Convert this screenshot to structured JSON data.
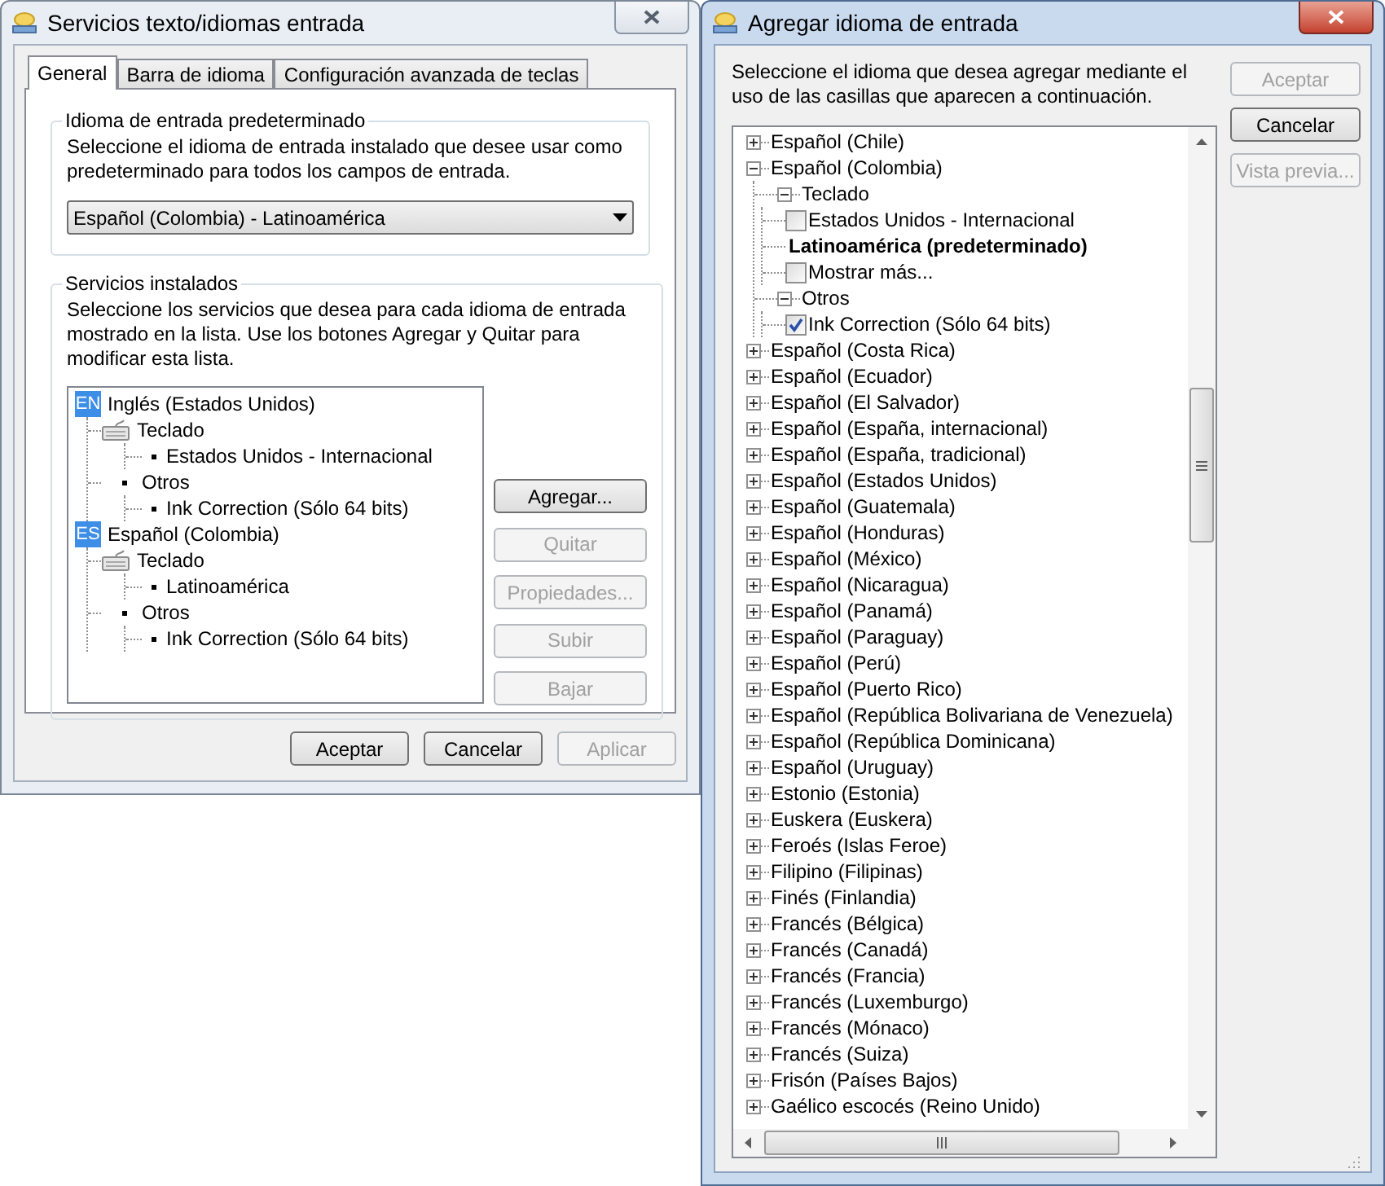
{
  "left_window": {
    "title": "Servicios texto/idiomas entrada",
    "tabs": [
      {
        "label": "General",
        "selected": true
      },
      {
        "label": "Barra de idioma",
        "selected": false
      },
      {
        "label": "Configuración avanzada de teclas",
        "selected": false
      }
    ],
    "default_language": {
      "legend": "Idioma de entrada predeterminado",
      "description": "Seleccione el idioma de entrada instalado que desee usar como predeterminado para todos los campos de entrada.",
      "value": "Español (Colombia) - Latinoamérica"
    },
    "installed_services": {
      "legend": "Servicios instalados",
      "description": "Seleccione los servicios que desea para cada idioma de entrada mostrado en la lista. Use los botones Agregar y Quitar para modificar esta lista.",
      "tree": [
        {
          "badge": "EN",
          "label": "Inglés (Estados Unidos)",
          "children": [
            {
              "kind": "keyboard",
              "label": "Teclado",
              "children": [
                {
                  "label": "Estados Unidos - Internacional"
                }
              ]
            },
            {
              "kind": "bullet",
              "label": "Otros",
              "children": [
                {
                  "label": "Ink Correction (Sólo 64 bits)"
                }
              ]
            }
          ]
        },
        {
          "badge": "ES",
          "label": "Español (Colombia)",
          "children": [
            {
              "kind": "keyboard",
              "label": "Teclado",
              "children": [
                {
                  "label": "Latinoamérica"
                }
              ]
            },
            {
              "kind": "bullet",
              "label": "Otros",
              "children": [
                {
                  "label": "Ink Correction (Sólo 64 bits)"
                }
              ]
            }
          ]
        }
      ],
      "buttons": [
        {
          "label": "Agregar...",
          "disabled": false
        },
        {
          "label": "Quitar",
          "disabled": true
        },
        {
          "label": "Propiedades...",
          "disabled": true
        },
        {
          "label": "Subir",
          "disabled": true
        },
        {
          "label": "Bajar",
          "disabled": true
        }
      ]
    },
    "buttons": [
      {
        "label": "Aceptar",
        "disabled": false
      },
      {
        "label": "Cancelar",
        "disabled": false
      },
      {
        "label": "Aplicar",
        "disabled": true
      }
    ]
  },
  "right_window": {
    "title": "Agregar idioma de entrada",
    "description": "Seleccione el idioma que desea agregar mediante el uso de las casillas que aparecen a continuación.",
    "buttons": [
      {
        "label": "Aceptar",
        "disabled": true
      },
      {
        "label": "Cancelar",
        "disabled": false
      },
      {
        "label": "Vista previa...",
        "disabled": true
      }
    ],
    "tree": [
      {
        "kind": "node",
        "label": "Español (Chile)",
        "expanded": false
      },
      {
        "kind": "node",
        "label": "Español (Colombia)",
        "expanded": true,
        "children": [
          {
            "kind": "node",
            "label": "Teclado",
            "expanded": true,
            "children": [
              {
                "kind": "check",
                "label": "Estados Unidos - Internacional",
                "checked": false
              },
              {
                "kind": "bold",
                "label": "Latinoamérica (predeterminado)"
              },
              {
                "kind": "check",
                "label": "Mostrar más...",
                "checked": false
              }
            ]
          },
          {
            "kind": "node",
            "label": "Otros",
            "expanded": true,
            "children": [
              {
                "kind": "check",
                "label": "Ink Correction (Sólo 64 bits)",
                "checked": true
              }
            ]
          }
        ]
      },
      {
        "kind": "node",
        "label": "Español (Costa Rica)",
        "expanded": false
      },
      {
        "kind": "node",
        "label": "Español (Ecuador)",
        "expanded": false
      },
      {
        "kind": "node",
        "label": "Español (El Salvador)",
        "expanded": false
      },
      {
        "kind": "node",
        "label": "Español (España, internacional)",
        "expanded": false
      },
      {
        "kind": "node",
        "label": "Español (España, tradicional)",
        "expanded": false
      },
      {
        "kind": "node",
        "label": "Español (Estados Unidos)",
        "expanded": false
      },
      {
        "kind": "node",
        "label": "Español (Guatemala)",
        "expanded": false
      },
      {
        "kind": "node",
        "label": "Español (Honduras)",
        "expanded": false
      },
      {
        "kind": "node",
        "label": "Español (México)",
        "expanded": false
      },
      {
        "kind": "node",
        "label": "Español (Nicaragua)",
        "expanded": false
      },
      {
        "kind": "node",
        "label": "Español (Panamá)",
        "expanded": false
      },
      {
        "kind": "node",
        "label": "Español (Paraguay)",
        "expanded": false
      },
      {
        "kind": "node",
        "label": "Español (Perú)",
        "expanded": false
      },
      {
        "kind": "node",
        "label": "Español (Puerto Rico)",
        "expanded": false
      },
      {
        "kind": "node",
        "label": "Español (República Bolivariana de Venezuela)",
        "expanded": false
      },
      {
        "kind": "node",
        "label": "Español (República Dominicana)",
        "expanded": false
      },
      {
        "kind": "node",
        "label": "Español (Uruguay)",
        "expanded": false
      },
      {
        "kind": "node",
        "label": "Estonio (Estonia)",
        "expanded": false
      },
      {
        "kind": "node",
        "label": "Euskera (Euskera)",
        "expanded": false
      },
      {
        "kind": "node",
        "label": "Feroés (Islas Feroe)",
        "expanded": false
      },
      {
        "kind": "node",
        "label": "Filipino (Filipinas)",
        "expanded": false
      },
      {
        "kind": "node",
        "label": "Finés (Finlandia)",
        "expanded": false
      },
      {
        "kind": "node",
        "label": "Francés (Bélgica)",
        "expanded": false
      },
      {
        "kind": "node",
        "label": "Francés (Canadá)",
        "expanded": false
      },
      {
        "kind": "node",
        "label": "Francés (Francia)",
        "expanded": false
      },
      {
        "kind": "node",
        "label": "Francés (Luxemburgo)",
        "expanded": false
      },
      {
        "kind": "node",
        "label": "Francés (Mónaco)",
        "expanded": false
      },
      {
        "kind": "node",
        "label": "Francés (Suiza)",
        "expanded": false
      },
      {
        "kind": "node",
        "label": "Frisón (Países Bajos)",
        "expanded": false
      },
      {
        "kind": "node",
        "label": "Gaélico escocés (Reino Unido)",
        "expanded": false
      }
    ]
  }
}
